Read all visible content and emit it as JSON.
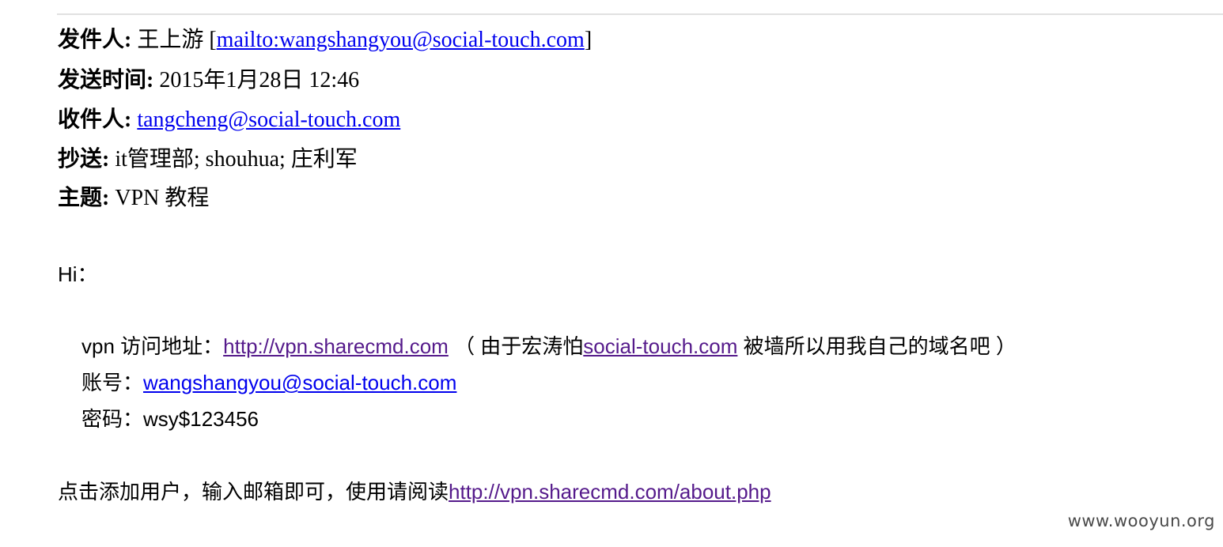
{
  "header": {
    "from": {
      "label": "发件人:",
      "name": "王上游",
      "bracket_open": "[",
      "link": "mailto:wangshangyou@social-touch.com",
      "bracket_close": "]"
    },
    "sent": {
      "label": "发送时间:",
      "value": "2015年1月28日 12:46"
    },
    "to": {
      "label": "收件人:",
      "link": "tangcheng@social-touch.com"
    },
    "cc": {
      "label": "抄送:",
      "value": "it管理部; shouhua; 庄利军"
    },
    "subject": {
      "label": "主题:",
      "value": "VPN 教程"
    }
  },
  "body": {
    "greeting": "Hi：",
    "vpn": {
      "prefix": "vpn 访问地址：",
      "link": "http://vpn.sharecmd.com",
      "middle": " （ 由于宏涛怕",
      "domain_link": "social-touch.com",
      "suffix": " 被墙所以用我自己的域名吧 ）"
    },
    "account": {
      "label": "账号：",
      "link": "wangshangyou@social-touch.com"
    },
    "password": {
      "label": "密码：",
      "value": "wsy$123456"
    },
    "instructions": {
      "text": "点击添加用户，输入邮箱即可，使用请阅读",
      "link": "http://vpn.sharecmd.com/about.php"
    }
  },
  "watermark": "www.wooyun.org"
}
